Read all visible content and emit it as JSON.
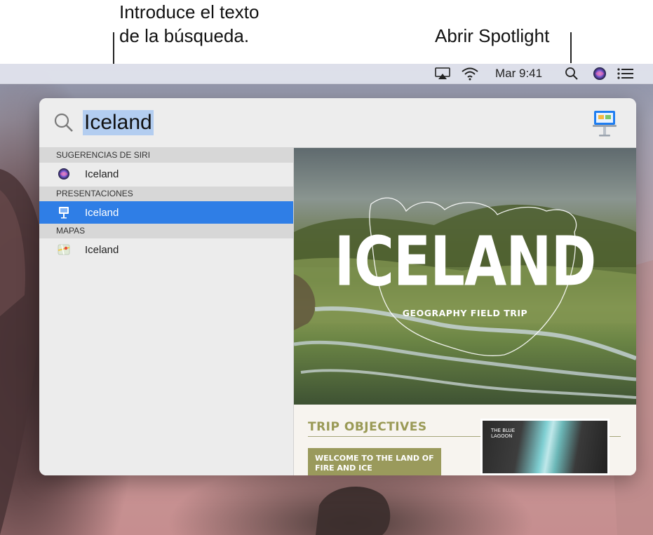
{
  "callouts": {
    "search_line1": "Introduce el texto",
    "search_line2": "de la búsqueda.",
    "spotlight": "Abrir Spotlight"
  },
  "menubar": {
    "time": "Mar 9:41",
    "icons": [
      "airplay-icon",
      "wifi-icon",
      "spotlight-search-icon",
      "siri-icon",
      "notification-center-icon"
    ]
  },
  "search": {
    "query": "Iceland"
  },
  "results": {
    "sections": [
      {
        "heading": "SUGERENCIAS DE SIRI",
        "items": [
          {
            "label": "Iceland",
            "icon": "siri-icon"
          }
        ]
      },
      {
        "heading": "PRESENTACIONES",
        "items": [
          {
            "label": "Iceland",
            "icon": "keynote-icon",
            "selected": true
          }
        ]
      },
      {
        "heading": "MAPAS",
        "items": [
          {
            "label": "Iceland",
            "icon": "maps-icon"
          }
        ]
      }
    ]
  },
  "preview": {
    "title": "ICELAND",
    "subtitle": "GEOGRAPHY FIELD TRIP",
    "objectives_title": "TRIP OBJECTIVES",
    "objectives_box": "WELCOME TO THE LAND OF FIRE AND ICE",
    "photo_label": "THE BLUE LAGOON"
  },
  "colors": {
    "selection": "#2f7ee6",
    "search_highlight": "#b3cdf0",
    "accent_olive": "#9a9a5c"
  }
}
